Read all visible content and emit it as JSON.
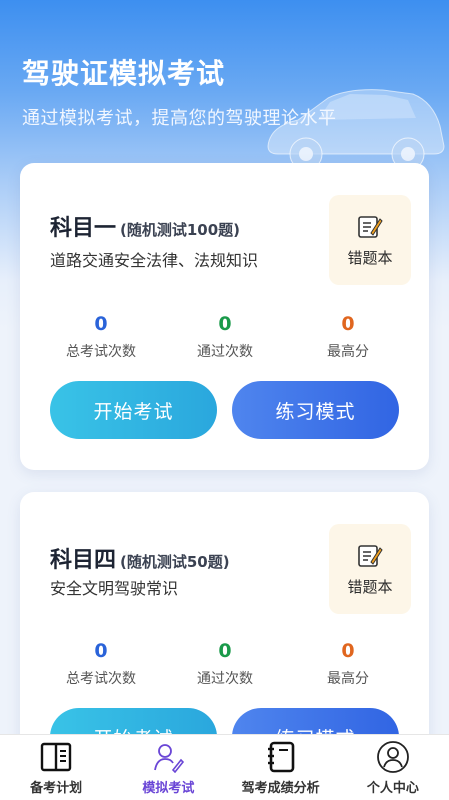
{
  "header": {
    "title": "驾驶证模拟考试",
    "subtitle": "通过模拟考试，提高您的驾驶理论水平"
  },
  "colors": {
    "count_total": "#2a63d9",
    "count_passed": "#1a9a4a",
    "count_best": "#e0661f",
    "active_tab": "#6a46d6"
  },
  "subjects": [
    {
      "name": "科目一",
      "tag": "(随机测试100题)",
      "description": "道路交通安全法律、法规知识",
      "wrong_label": "错题本",
      "stats": [
        {
          "value": "0",
          "label": "总考试次数"
        },
        {
          "value": "0",
          "label": "通过次数"
        },
        {
          "value": "0",
          "label": "最高分"
        }
      ],
      "start_label": "开始考试",
      "practice_label": "练习模式"
    },
    {
      "name": "科目四",
      "tag": "(随机测试50题)",
      "description": "安全文明驾驶常识",
      "wrong_label": "错题本",
      "stats": [
        {
          "value": "0",
          "label": "总考试次数"
        },
        {
          "value": "0",
          "label": "通过次数"
        },
        {
          "value": "0",
          "label": "最高分"
        }
      ],
      "start_label": "开始考试",
      "practice_label": "练习模式"
    }
  ],
  "tabbar": [
    {
      "label": "备考计划",
      "icon": "book-open-icon",
      "active": false
    },
    {
      "label": "模拟考试",
      "icon": "person-pen-icon",
      "active": true
    },
    {
      "label": "驾考成绩分析",
      "icon": "notebook-icon",
      "active": false
    },
    {
      "label": "个人中心",
      "icon": "user-circle-icon",
      "active": false
    }
  ]
}
